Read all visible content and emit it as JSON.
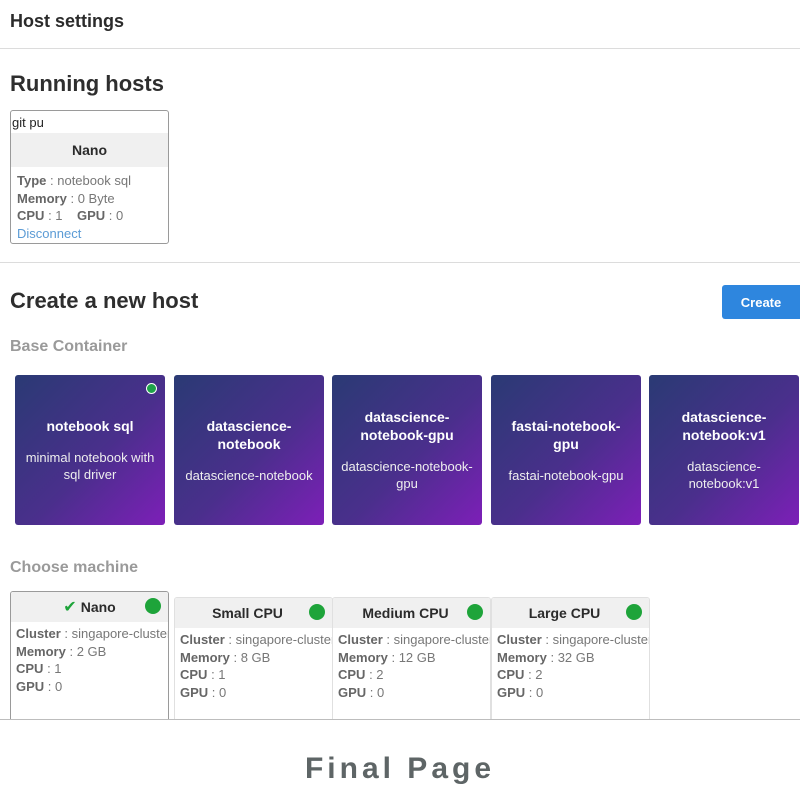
{
  "header": {
    "title": "Host settings"
  },
  "running": {
    "title": "Running hosts",
    "host": {
      "input_value": "git pu",
      "name": "Nano",
      "type_label": "Type",
      "type_value": "notebook sql",
      "memory_label": "Memory",
      "memory_value": "0 Byte",
      "cpu_label": "CPU",
      "cpu_value": "1",
      "gpu_label": "GPU",
      "gpu_value": "0",
      "disconnect_label": "Disconnect"
    }
  },
  "create": {
    "title": "Create a new host",
    "button_label": "Create",
    "base_container_title": "Base Container",
    "containers": [
      {
        "name": "notebook sql",
        "desc": "minimal notebook with sql driver",
        "selected": true
      },
      {
        "name": "datascience-notebook",
        "desc": "datascience-notebook",
        "selected": false
      },
      {
        "name": "datascience-notebook-gpu",
        "desc": "datascience-notebook-gpu",
        "selected": false
      },
      {
        "name": "fastai-notebook-gpu",
        "desc": "fastai-notebook-gpu",
        "selected": false
      },
      {
        "name": "datascience-notebook:v1",
        "desc": "datascience-notebook:v1",
        "selected": false
      }
    ],
    "machine_title": "Choose machine",
    "machines": [
      {
        "name": "Nano",
        "cluster_label": "Cluster",
        "cluster": "singapore-cluster",
        "memory_label": "Memory",
        "memory": "2 GB",
        "cpu_label": "CPU",
        "cpu": "1",
        "gpu_label": "GPU",
        "gpu": "0",
        "selected": true
      },
      {
        "name": "Small CPU",
        "cluster_label": "Cluster",
        "cluster": "singapore-cluster",
        "memory_label": "Memory",
        "memory": "8 GB",
        "cpu_label": "CPU",
        "cpu": "1",
        "gpu_label": "GPU",
        "gpu": "0",
        "selected": false
      },
      {
        "name": "Medium CPU",
        "cluster_label": "Cluster",
        "cluster": "singapore-cluster",
        "memory_label": "Memory",
        "memory": "12 GB",
        "cpu_label": "CPU",
        "cpu": "2",
        "gpu_label": "GPU",
        "gpu": "0",
        "selected": false
      },
      {
        "name": "Large CPU",
        "cluster_label": "Cluster",
        "cluster": "singapore-cluster",
        "memory_label": "Memory",
        "memory": "32 GB",
        "cpu_label": "CPU",
        "cpu": "2",
        "gpu_label": "GPU",
        "gpu": "0",
        "selected": false
      }
    ]
  },
  "footer": {
    "caption": "Final Page"
  },
  "colors": {
    "accent": "#2e86de",
    "status_green": "#1ea43a",
    "link": "#5b9bd5",
    "gradient_start": "#2a3a74",
    "gradient_end": "#7d1fb8"
  }
}
